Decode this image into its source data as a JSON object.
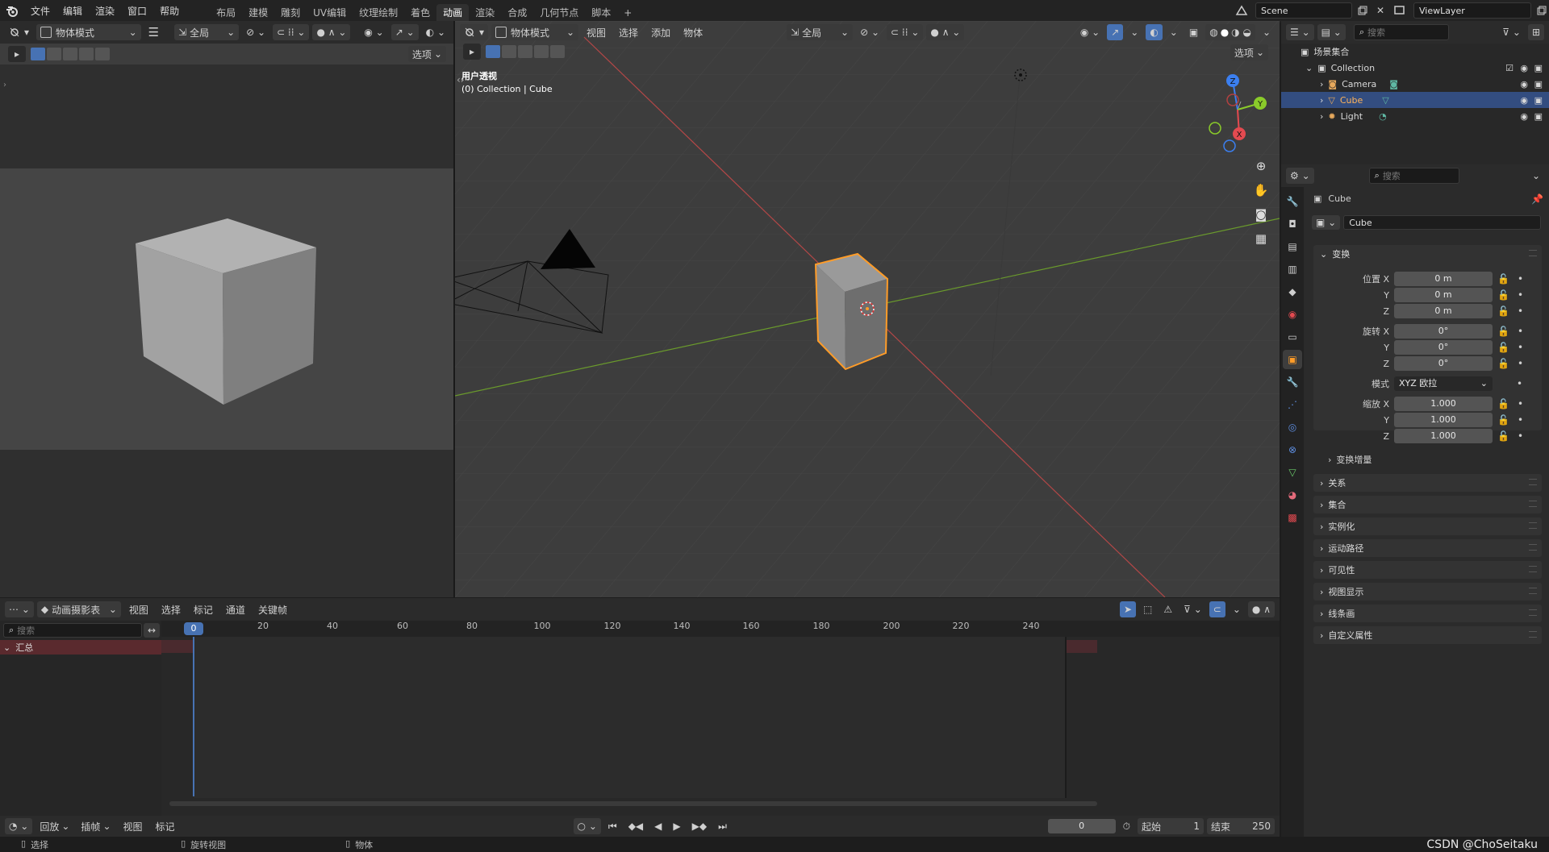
{
  "topbar": {
    "menus": [
      "文件",
      "编辑",
      "渲染",
      "窗口",
      "帮助"
    ],
    "workspaces": [
      "布局",
      "建模",
      "雕刻",
      "UV编辑",
      "纹理绘制",
      "着色",
      "动画",
      "渲染",
      "合成",
      "几何节点",
      "脚本"
    ],
    "active_workspace": "动画",
    "add_tab": "+",
    "scene": "Scene",
    "view_layer": "ViewLayer"
  },
  "left_viewport": {
    "mode": "物体模式",
    "orientation": "全局",
    "options": "选项"
  },
  "main_viewport": {
    "mode": "物体模式",
    "menus": [
      "视图",
      "选择",
      "添加",
      "物体"
    ],
    "orientation": "全局",
    "options": "选项",
    "view_name": "用户透视",
    "view_info": "(0) Collection | Cube",
    "gizmo": {
      "x": "X",
      "y": "Y",
      "z": "Z"
    }
  },
  "outliner": {
    "search_placeholder": "搜索",
    "root": "场景集合",
    "collection": "Collection",
    "items": [
      {
        "name": "Camera",
        "selected": false
      },
      {
        "name": "Cube",
        "selected": true
      },
      {
        "name": "Light",
        "selected": false
      }
    ]
  },
  "properties": {
    "search_placeholder": "搜索",
    "object_name": "Cube",
    "datablock_name": "Cube",
    "transform_title": "变换",
    "location_label": "位置 X",
    "rotation_label": "旋转 X",
    "scale_label": "缩放 X",
    "y_label": "Y",
    "z_label": "Z",
    "location": [
      "0 m",
      "0 m",
      "0 m"
    ],
    "rotation": [
      "0°",
      "0°",
      "0°"
    ],
    "mode_label": "模式",
    "mode_value": "XYZ 欧拉",
    "scale": [
      "1.000",
      "1.000",
      "1.000"
    ],
    "delta_transform": "变换增量",
    "panels": [
      "关系",
      "集合",
      "实例化",
      "运动路径",
      "可见性",
      "视图显示",
      "线条画",
      "自定义属性"
    ]
  },
  "dopesheet": {
    "editor_mode": "动画摄影表",
    "menus": [
      "视图",
      "选择",
      "标记",
      "通道",
      "关键帧"
    ],
    "search_placeholder": "搜索",
    "summary": "汇总",
    "current_frame_label": "0",
    "ruler": [
      "20",
      "40",
      "60",
      "80",
      "100",
      "120",
      "140",
      "160",
      "180",
      "200",
      "220",
      "240"
    ]
  },
  "timeline": {
    "menus": [
      "回放",
      "插帧",
      "视图",
      "标记"
    ],
    "current_frame": "0",
    "start_label": "起始",
    "start_value": "1",
    "end_label": "结束",
    "end_value": "250"
  },
  "statusbar": {
    "select": "选择",
    "rotate_view": "旋转视图",
    "object": "物体",
    "watermark": "CSDN @ChoSeitaku"
  }
}
